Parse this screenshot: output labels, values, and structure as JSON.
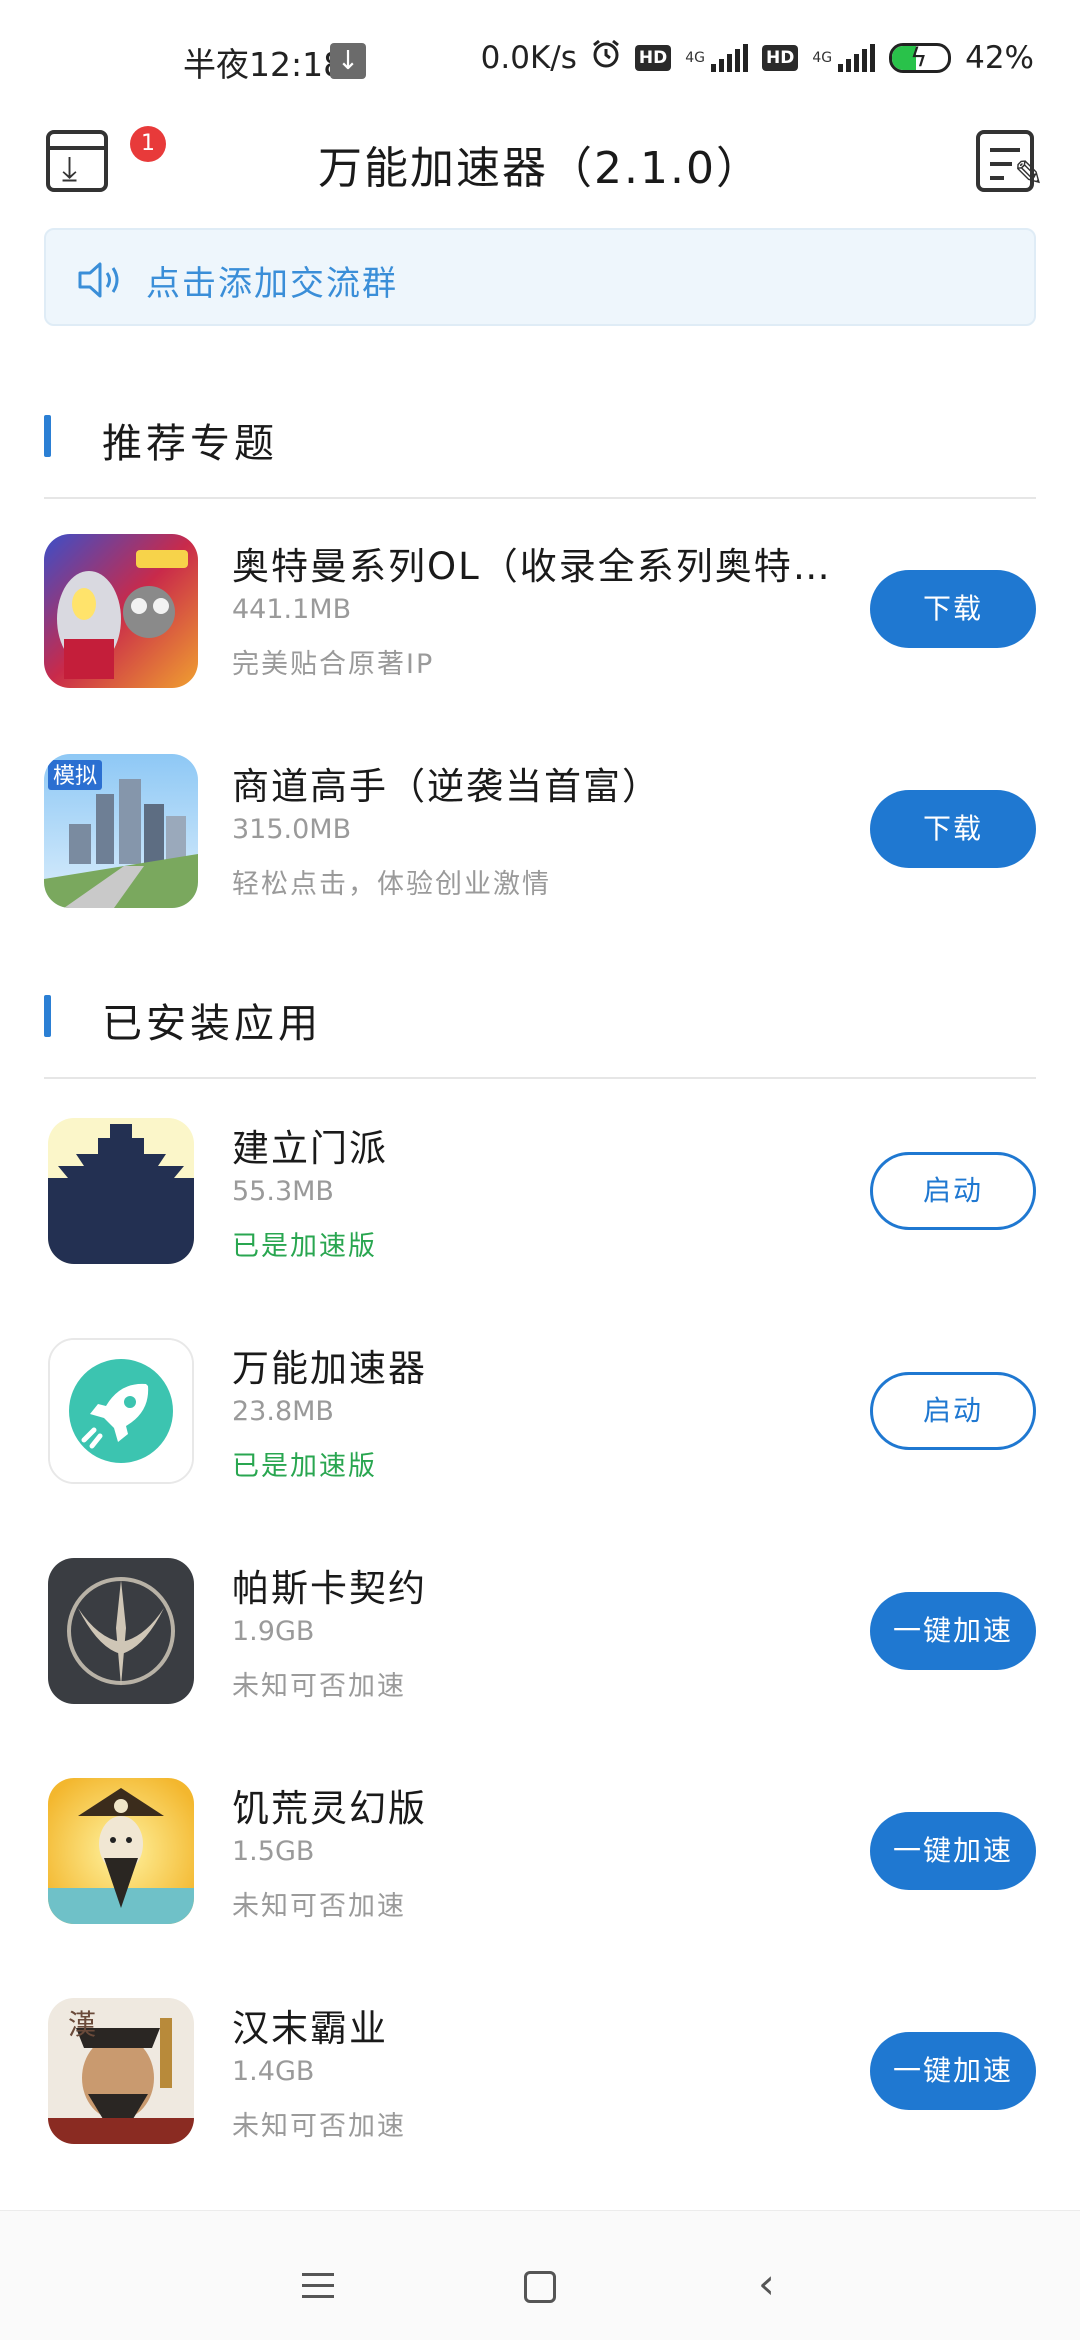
{
  "status_bar": {
    "time": "半夜12:18",
    "speed": "0.0K/s",
    "net1": "4G",
    "net2": "4G",
    "hd": "HD",
    "battery_text": "42%",
    "battery_level": 0.42,
    "icons": [
      "download-icon",
      "alarm-icon",
      "hd-icon",
      "signal-icon",
      "battery-charging-icon"
    ]
  },
  "header": {
    "title": "万能加速器（2.1.0）",
    "download_badge": "1"
  },
  "notice": {
    "text": "点击添加交流群"
  },
  "recommended": {
    "title": "推荐专题",
    "items": [
      {
        "name": "奥特曼系列OL（收录全系列奥特曼）",
        "size": "441.1MB",
        "desc": "完美贴合原著IP",
        "button": "下载"
      },
      {
        "name": "商道高手（逆袭当首富）",
        "size": "315.0MB",
        "desc": "轻松点击，体验创业激情",
        "button": "下载"
      }
    ]
  },
  "installed": {
    "title": "已安装应用",
    "items": [
      {
        "name": "建立门派",
        "size": "55.3MB",
        "desc": "已是加速版",
        "button": "启动"
      },
      {
        "name": "万能加速器",
        "size": "23.8MB",
        "desc": "已是加速版",
        "button": "启动"
      },
      {
        "name": "帕斯卡契约",
        "size": "1.9GB",
        "desc": "未知可否加速",
        "button": "一键加速"
      },
      {
        "name": "饥荒灵幻版",
        "size": "1.5GB",
        "desc": "未知可否加速",
        "button": "一键加速"
      },
      {
        "name": "汉末霸业",
        "size": "1.4GB",
        "desc": "未知可否加速",
        "button": "一键加速"
      }
    ]
  },
  "icon_text": {
    "moni": "模拟",
    "han": "漢"
  },
  "colors": {
    "accent": "#1f78d1",
    "green": "#29a650",
    "badge": "#e83a3a",
    "notice_bg": "#eef6fc"
  }
}
